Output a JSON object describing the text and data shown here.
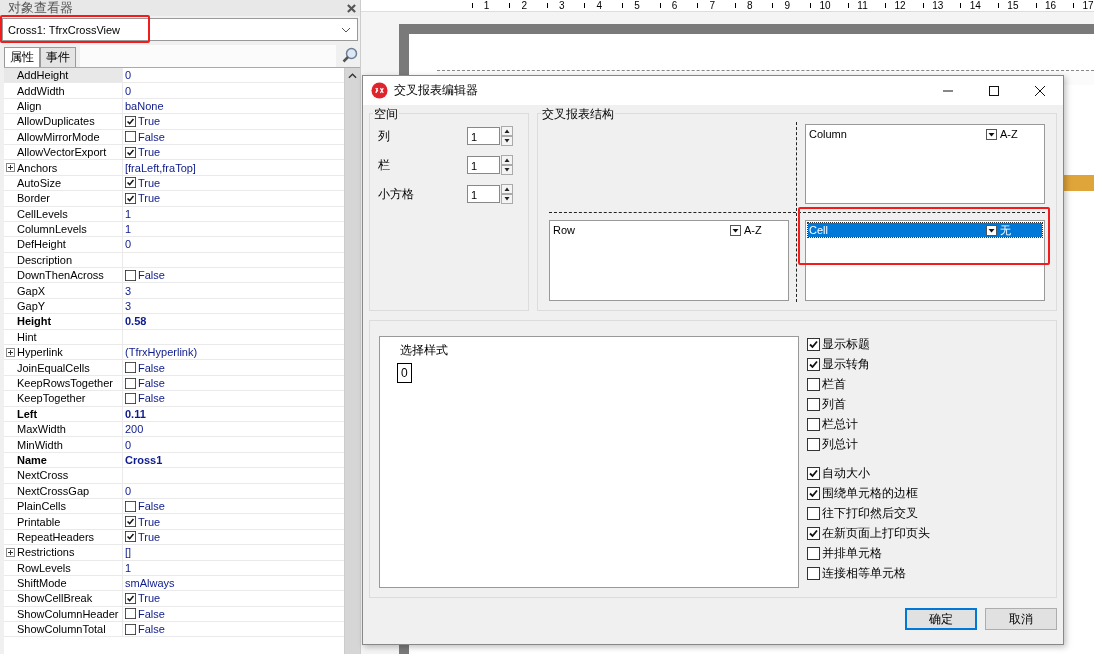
{
  "inspector": {
    "title": "对象查看器",
    "object": "Cross1: TfrxCrossView",
    "tabs": [
      {
        "label": "属性",
        "selected": true
      },
      {
        "label": "事件",
        "selected": false
      }
    ],
    "properties": [
      {
        "name": "AddHeight",
        "value": "0",
        "kind": "text",
        "selected": true
      },
      {
        "name": "AddWidth",
        "value": "0",
        "kind": "text",
        "selected": false
      },
      {
        "name": "Align",
        "value": "baNone",
        "kind": "text",
        "selected": false
      },
      {
        "name": "AllowDuplicates",
        "value": "True",
        "kind": "check",
        "checked": true,
        "selected": false
      },
      {
        "name": "AllowMirrorMode",
        "value": "False",
        "kind": "check",
        "checked": false,
        "selected": false
      },
      {
        "name": "AllowVectorExport",
        "value": "True",
        "kind": "check",
        "checked": true,
        "selected": false
      },
      {
        "name": "Anchors",
        "value": "[fraLeft,fraTop]",
        "kind": "text",
        "expandable": true,
        "selected": false
      },
      {
        "name": "AutoSize",
        "value": "True",
        "kind": "check",
        "checked": true,
        "selected": false
      },
      {
        "name": "Border",
        "value": "True",
        "kind": "check",
        "checked": true,
        "selected": false
      },
      {
        "name": "CellLevels",
        "value": "1",
        "kind": "text",
        "selected": false
      },
      {
        "name": "ColumnLevels",
        "value": "1",
        "kind": "text",
        "selected": false
      },
      {
        "name": "DefHeight",
        "value": "0",
        "kind": "text",
        "selected": false
      },
      {
        "name": "Description",
        "kind": "text",
        "selected": false
      },
      {
        "name": "DownThenAcross",
        "value": "False",
        "kind": "check",
        "checked": false,
        "selected": false
      },
      {
        "name": "GapX",
        "value": "3",
        "kind": "text",
        "selected": false
      },
      {
        "name": "GapY",
        "value": "3",
        "kind": "text",
        "selected": false
      },
      {
        "name": "Height",
        "value": "0.58",
        "kind": "text",
        "bold": true,
        "selected": false
      },
      {
        "name": "Hint",
        "kind": "text",
        "selected": false
      },
      {
        "name": "Hyperlink",
        "value": "(TfrxHyperlink)",
        "kind": "text",
        "expandable": true,
        "selected": false
      },
      {
        "name": "JoinEqualCells",
        "value": "False",
        "kind": "check",
        "checked": false,
        "selected": false
      },
      {
        "name": "KeepRowsTogether",
        "value": "False",
        "kind": "check",
        "checked": false,
        "selected": false
      },
      {
        "name": "KeepTogether",
        "value": "False",
        "kind": "check",
        "checked": false,
        "selected": false
      },
      {
        "name": "Left",
        "value": "0.11",
        "kind": "text",
        "bold": true,
        "selected": false
      },
      {
        "name": "MaxWidth",
        "value": "200",
        "kind": "text",
        "selected": false
      },
      {
        "name": "MinWidth",
        "value": "0",
        "kind": "text",
        "selected": false
      },
      {
        "name": "Name",
        "value": "Cross1",
        "kind": "text",
        "bold": true,
        "selected": false
      },
      {
        "name": "NextCross",
        "kind": "text",
        "selected": false
      },
      {
        "name": "NextCrossGap",
        "value": "0",
        "kind": "text",
        "selected": false
      },
      {
        "name": "PlainCells",
        "value": "False",
        "kind": "check",
        "checked": false,
        "selected": false
      },
      {
        "name": "Printable",
        "value": "True",
        "kind": "check",
        "checked": true,
        "selected": false
      },
      {
        "name": "RepeatHeaders",
        "value": "True",
        "kind": "check",
        "checked": true,
        "selected": false
      },
      {
        "name": "Restrictions",
        "value": "[]",
        "kind": "text",
        "expandable": true,
        "selected": false
      },
      {
        "name": "RowLevels",
        "value": "1",
        "kind": "text",
        "selected": false
      },
      {
        "name": "ShiftMode",
        "value": "smAlways",
        "kind": "text",
        "selected": false
      },
      {
        "name": "ShowCellBreak",
        "value": "True",
        "kind": "check",
        "checked": true,
        "selected": false
      },
      {
        "name": "ShowColumnHeader",
        "value": "False",
        "kind": "check",
        "checked": false,
        "selected": false
      },
      {
        "name": "ShowColumnTotal",
        "value": "False",
        "kind": "check",
        "checked": false,
        "selected": false
      }
    ]
  },
  "ruler": {
    "marks": [
      "1",
      "2",
      "3",
      "4",
      "5",
      "6",
      "7",
      "8",
      "9",
      "10",
      "11",
      "12",
      "13",
      "14",
      "15",
      "16",
      "17"
    ]
  },
  "dialog": {
    "title": "交叉报表编辑器",
    "space": {
      "title": "空间",
      "fields": [
        {
          "label": "列",
          "value": "1"
        },
        {
          "label": "栏",
          "value": "1"
        },
        {
          "label": "小方格",
          "value": "1"
        }
      ]
    },
    "structure": {
      "title": "交叉报表结构",
      "lists": [
        {
          "kind": "column",
          "header": "Column",
          "sort": "A-Z",
          "selected": false,
          "highlighted": false
        },
        {
          "kind": "row",
          "header": "Row",
          "sort": "A-Z",
          "selected": false,
          "highlighted": false
        },
        {
          "kind": "cell",
          "header": "Cell",
          "sort": "无",
          "selected": true,
          "highlighted": true
        }
      ]
    },
    "styles": {
      "title": "选择样式",
      "items": [
        {
          "label": "0"
        }
      ]
    },
    "option_groups": [
      [
        {
          "label": "显示标题",
          "checked": true
        },
        {
          "label": "显示转角",
          "checked": true
        },
        {
          "label": "栏首",
          "checked": false
        },
        {
          "label": "列首",
          "checked": false
        },
        {
          "label": "栏总计",
          "checked": false
        },
        {
          "label": "列总计",
          "checked": false
        }
      ],
      [
        {
          "label": "自动大小",
          "checked": true
        },
        {
          "label": "围绕单元格的边框",
          "checked": true
        },
        {
          "label": "往下打印然后交叉",
          "checked": false
        },
        {
          "label": "在新页面上打印页头",
          "checked": true
        },
        {
          "label": "并排单元格",
          "checked": false
        },
        {
          "label": "连接相等单元格",
          "checked": false
        }
      ]
    ],
    "buttons": [
      {
        "label": "确定",
        "default": true
      },
      {
        "label": "取消",
        "default": false
      }
    ]
  },
  "highlight_object_field": true
}
